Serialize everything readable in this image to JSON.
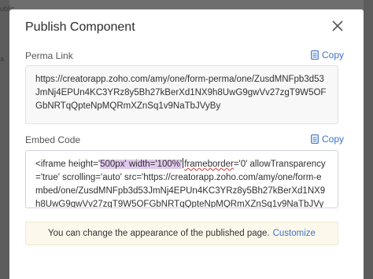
{
  "backdrop": {
    "fragment_top": "ublic",
    "fragment_mid": "a"
  },
  "modal": {
    "title": "Publish Component"
  },
  "perma_link": {
    "label": "Perma Link",
    "copy_label": "Copy",
    "value": "https://creatorapp.zoho.com/amy/one/form-perma/one/ZusdMNFpb3d53JmNj4EPUn4KC3YRz8y5Bh27kBerXd1NX9h8UwG9gwVv27zgT9W5OFGbNRTqQpteNpMQRmXZnSq1v9NaTbJVyBy"
  },
  "embed_code": {
    "label": "Embed Code",
    "copy_label": "Copy",
    "prefix": "<iframe height='",
    "highlight": "500px' width='100%'",
    "suffix_word": "frameborder",
    "suffix": "='0' allowTransparency='true' scrolling='auto' src='https://creatorapp.zoho.com/amy/one/form-embed/one/ZusdMNFpb3d53JmNj4EPUn4KC3YRz8y5Bh27kBerXd1NX9h8UwG9gwVv27zgT9W5OFGbNRTqQpteNpMQRmXZnSq1v9NaTbJVyBy'></iframe>"
  },
  "info": {
    "text": "You can change the appearance of the published page.",
    "link": "Customize"
  },
  "colors": {
    "accent": "#3c73c8",
    "highlight": "#e0c9ec",
    "info_bg": "#fdf8ec"
  }
}
